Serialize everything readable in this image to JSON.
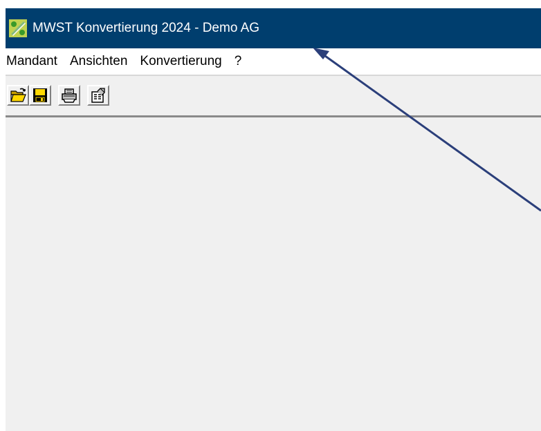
{
  "window": {
    "title": "MWST Konvertierung 2024 - Demo AG",
    "app_icon": "percent-icon",
    "titlebar_color": "#003e6e"
  },
  "menu": {
    "items": [
      {
        "label": "Mandant"
      },
      {
        "label": "Ansichten"
      },
      {
        "label": "Konvertierung"
      },
      {
        "label": "?"
      }
    ]
  },
  "toolbar": {
    "buttons": [
      {
        "icon": "open-folder-icon"
      },
      {
        "icon": "save-icon"
      },
      {
        "icon": "print-icon"
      },
      {
        "icon": "properties-icon"
      }
    ]
  },
  "annotation": {
    "icon": "arrow-icon",
    "color": "#2b3f7a"
  }
}
